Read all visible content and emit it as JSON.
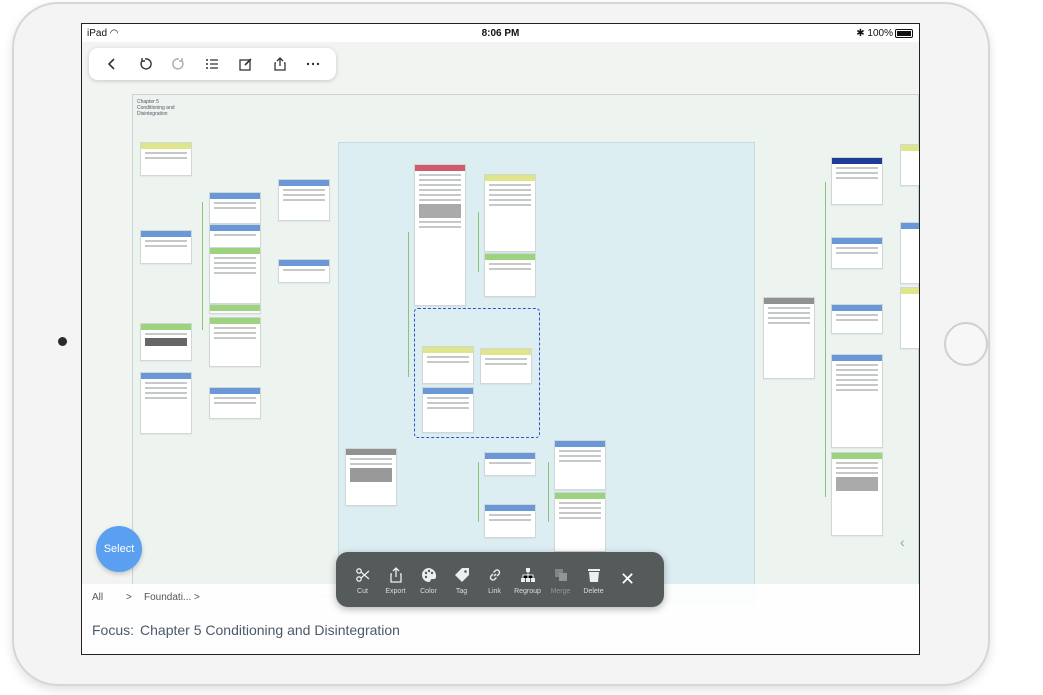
{
  "status_bar": {
    "carrier": "iPad",
    "time": "8:06 PM",
    "battery": "100%"
  },
  "toolbar": {
    "items": [
      {
        "icon": "back-icon"
      },
      {
        "icon": "undo-icon"
      },
      {
        "icon": "redo-icon"
      },
      {
        "icon": "outline-list-icon"
      },
      {
        "icon": "edit-icon"
      },
      {
        "icon": "share-icon"
      },
      {
        "icon": "more-icon"
      }
    ]
  },
  "canvas": {
    "left_zone_title": "Chapter 5 Conditioning and Disintegration",
    "right_zone_title": "Conditioning and Disintegration"
  },
  "select_button": {
    "label": "Select"
  },
  "breadcrumb": {
    "root": "All",
    "sep1": ">",
    "item": "Foundati...",
    "sep2": ">"
  },
  "focus": {
    "label": "Focus:",
    "value": "Chapter 5 Conditioning and Disintegration"
  },
  "action_bar": {
    "actions": [
      {
        "icon": "scissors-icon",
        "label": "Cut"
      },
      {
        "icon": "export-icon",
        "label": "Export"
      },
      {
        "icon": "palette-icon",
        "label": "Color"
      },
      {
        "icon": "tag-icon",
        "label": "Tag"
      },
      {
        "icon": "link-icon",
        "label": "Link"
      },
      {
        "icon": "regroup-icon",
        "label": "Regroup"
      },
      {
        "icon": "merge-icon",
        "label": "Merge"
      },
      {
        "icon": "trash-icon",
        "label": "Delete"
      }
    ],
    "close_icon": "close-icon"
  },
  "colors": {
    "select_button": "#5b9ff0",
    "action_bar": "#555a5b",
    "group_background": "#ddeef3",
    "selection_border": "#2f55c8"
  }
}
